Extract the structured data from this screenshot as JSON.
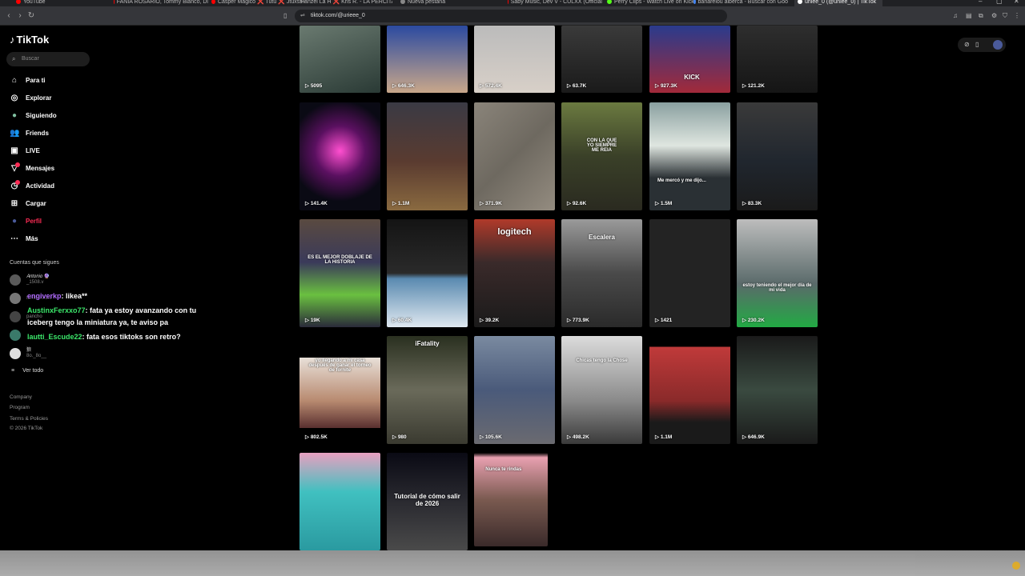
{
  "browser": {
    "tabs": [
      {
        "label": "YouTube",
        "color": "#ff0000"
      },
      {
        "label": "FANIA ROSARIO, Tommy Blanco, Di",
        "color": "#ff0000"
      },
      {
        "label": "Casper Magico ❌ Tutu ❌ Jtuxss -",
        "color": "#ff0000"
      },
      {
        "label": "Hanzel La H ❌ Kris R. - LA PERCITA",
        "color": "#ff0000"
      },
      {
        "label": "Nueva pestaña",
        "color": "#888888"
      },
      {
        "label": "Saby Music, Dev V - CULXX (Official",
        "color": "#ff0000"
      },
      {
        "label": "Perry Clips - Watch Live on Kick",
        "color": "#53fc18"
      },
      {
        "label": "banarelou alberca - Buscar con Goo",
        "color": "#4285f4"
      },
      {
        "label": "uniee_0 (@uniee_0) | TikTok",
        "color": "#ffffff"
      }
    ],
    "url": "tiktok.com/@urieee_0"
  },
  "sidebar": {
    "logo": "TikTok",
    "search_placeholder": "Buscar",
    "nav": [
      {
        "label": "Para ti",
        "icon": "home-icon"
      },
      {
        "label": "Explorar",
        "icon": "compass-icon"
      },
      {
        "label": "Siguiendo",
        "icon": "following-avatar-icon"
      },
      {
        "label": "Friends",
        "icon": "friends-icon"
      },
      {
        "label": "LIVE",
        "icon": "live-icon"
      },
      {
        "label": "Mensajes",
        "icon": "messages-icon"
      },
      {
        "label": "Actividad",
        "icon": "activity-icon"
      },
      {
        "label": "Cargar",
        "icon": "upload-icon"
      },
      {
        "label": "Perfil",
        "icon": "profile-avatar-icon"
      },
      {
        "label": "Más",
        "icon": "more-icon"
      }
    ],
    "following_title": "Cuentas que sigues",
    "following": [
      {
        "name": "𝐴𝑛𝑡𝑜𝑛𝑖𝑜 🔮",
        "handle": "_1508.v"
      },
      {
        "name": "",
        "handle": "fanfaresano"
      },
      {
        "name": "",
        "handle": "pancho"
      },
      {
        "name": "",
        "handle": ""
      },
      {
        "name": "狼",
        "handle": "8o._8o__"
      }
    ],
    "see_all": "Ver todo",
    "footer": [
      "Company",
      "Program",
      "Terms & Policies",
      "© 2026 TikTok"
    ]
  },
  "chat": [
    {
      "user": "engiverkp",
      "msg": ": likea**",
      "color": "#b26cff"
    },
    {
      "user": "AustinxFerxxo77",
      "msg": ": fata ya estoy avanzando con tu",
      "color": "#3ce86b"
    },
    {
      "user": "",
      "msg": "iceberg tengo la miniatura ya, te aviso pa",
      "color": "#ffffff"
    },
    {
      "user": "lautti_Escude22",
      "msg": ": fata esos tiktoks son retro?",
      "color": "#3ce86b"
    }
  ],
  "videos": [
    {
      "views": "5095",
      "caption": ""
    },
    {
      "views": "646.3K",
      "caption": ""
    },
    {
      "views": "572.4K",
      "caption": ""
    },
    {
      "views": "63.7K",
      "caption": ""
    },
    {
      "views": "927.3K",
      "caption": "KICK"
    },
    {
      "views": "121.2K",
      "caption": ""
    },
    {
      "views": "141.4K",
      "caption": ""
    },
    {
      "views": "1.1M",
      "caption": ""
    },
    {
      "views": "371.9K",
      "caption": ""
    },
    {
      "views": "92.6K",
      "caption": "CON LA QUE YO SIEMPRE ME REIA"
    },
    {
      "views": "1.5M",
      "caption": "Me mercó y me dijo..."
    },
    {
      "views": "83.3K",
      "caption": ""
    },
    {
      "views": "19K",
      "caption": "ES EL MEJOR DOBLAJE DE LA HISTORIA"
    },
    {
      "views": "60.4K",
      "caption": ""
    },
    {
      "views": "39.2K",
      "caption": "logitech"
    },
    {
      "views": "773.9K",
      "caption": "Escalera"
    },
    {
      "views": "1421",
      "caption": ""
    },
    {
      "views": "230.2K",
      "caption": "estoy teniendo el mejor día de mi vida"
    },
    {
      "views": "802.5K",
      "caption": "yo llegando a mi casa después de ganar el torneo de fornite"
    },
    {
      "views": "980",
      "caption": "iFatality"
    },
    {
      "views": "105.6K",
      "caption": ""
    },
    {
      "views": "498.2K",
      "caption": "Chicas tengo la Chose"
    },
    {
      "views": "1.1M",
      "caption": ""
    },
    {
      "views": "646.9K",
      "caption": ""
    },
    {
      "views": "",
      "caption": ""
    },
    {
      "views": "",
      "caption": "Tutorial de cómo salir de 2026"
    },
    {
      "views": "",
      "caption": "Nunca te rindas"
    }
  ],
  "colors": {
    "accent": "#fe2c55",
    "bg": "#000000"
  }
}
